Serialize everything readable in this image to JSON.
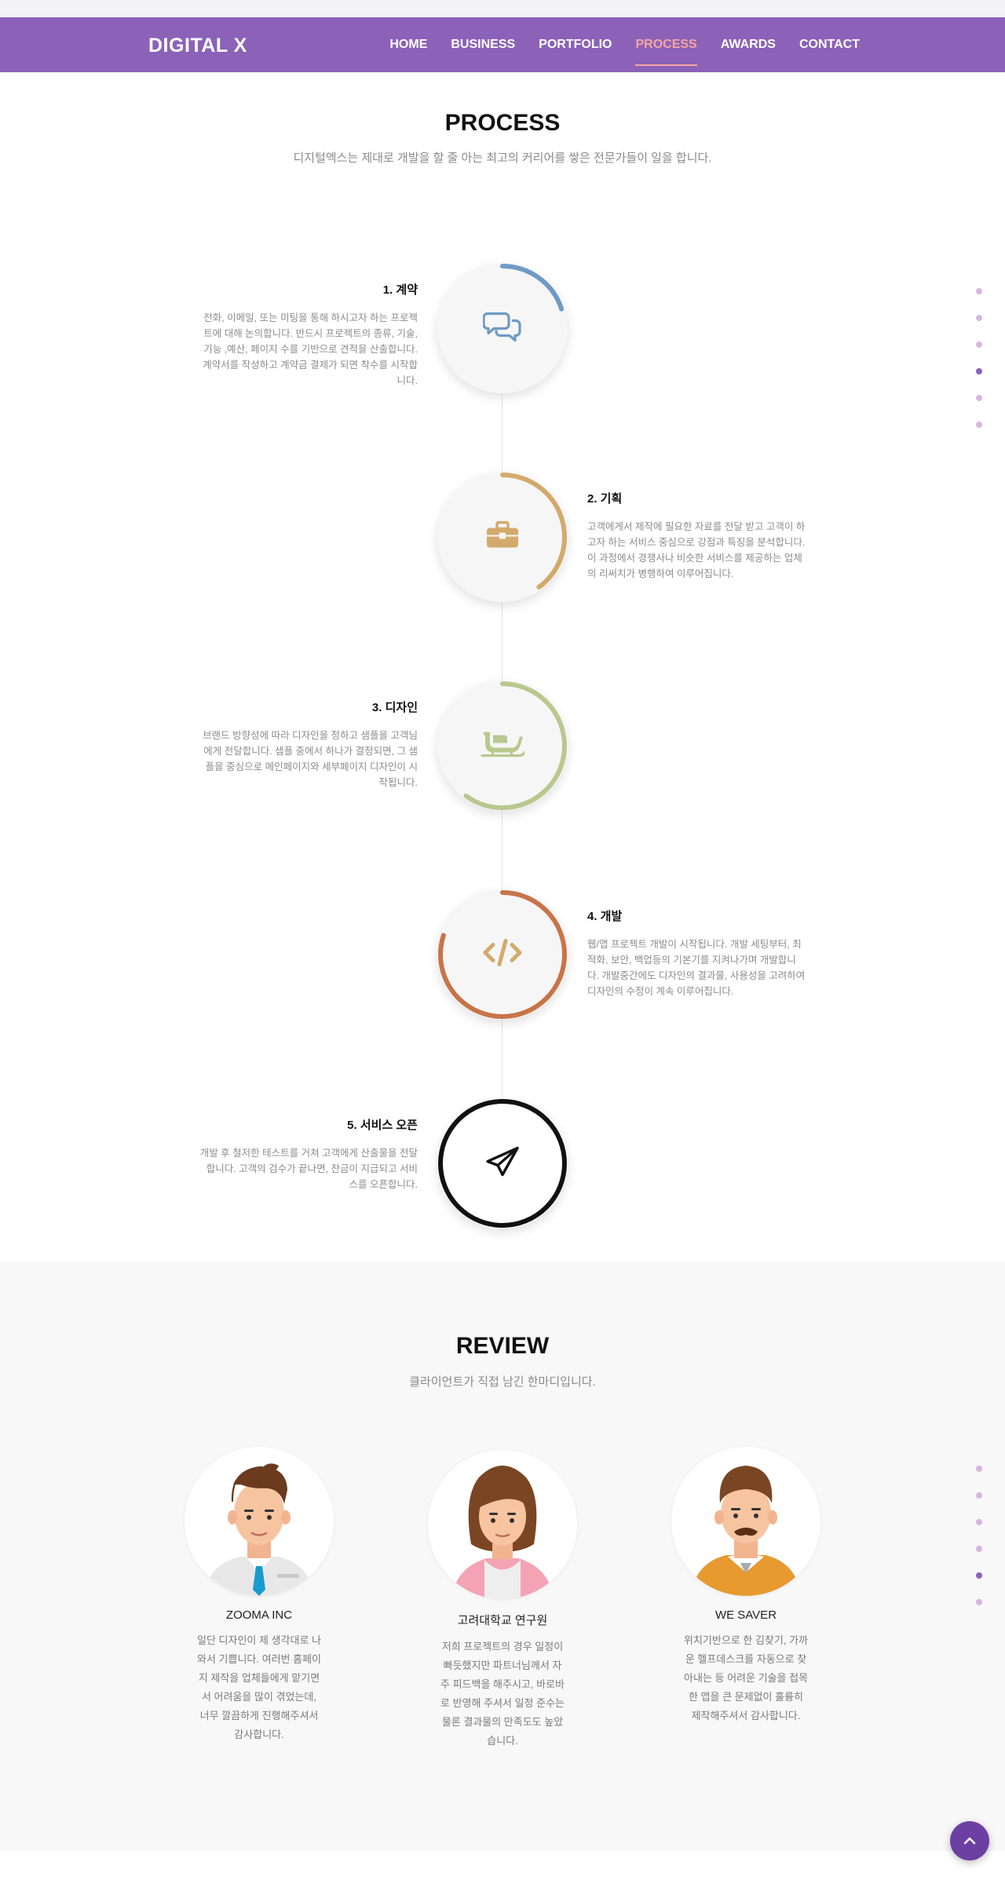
{
  "brand": {
    "logo": "DIGITAL X"
  },
  "nav": [
    {
      "label": "HOME",
      "active": false
    },
    {
      "label": "BUSINESS",
      "active": false
    },
    {
      "label": "PORTFOLIO",
      "active": false
    },
    {
      "label": "PROCESS",
      "active": true
    },
    {
      "label": "AWARDS",
      "active": false
    },
    {
      "label": "CONTACT",
      "active": false
    }
  ],
  "process": {
    "title": "PROCESS",
    "subtitle": "디지털엑스는 제대로 개발을 할 줄 아는 최고의 커리어를 쌓은 전문가들이 일을 합니다.",
    "steps": [
      {
        "title": "1. 계약",
        "desc": "전화, 이메일, 또는 미팅을 통해 하시고자 하는 프로젝트에 대해 논의합니다. 반드시 프로젝트의 종류, 기술, 기능 ,예산, 페이지 수를 기반으로 견적을 산출합니다. 계약서를 작성하고 계약금 결제가 되면 착수를 시작합니다.",
        "color": "#6e9ac4",
        "progress": 0.2,
        "icon": "chat-icon"
      },
      {
        "title": "2. 기획",
        "desc": "고객에게서 제작에 필요한 자료를 전달 받고 고객이 하고자 하는 서비스 중심으로 강점과 특징을 분석합니다. 이 과정에서 경쟁사나 비슷한 서비스를 제공하는 업체의 리써치가 병행하여 이루어집니다.",
        "color": "#d3aa6c",
        "progress": 0.4,
        "icon": "briefcase-icon"
      },
      {
        "title": "3. 디자인",
        "desc": "브랜드 방향성에 따라 디자인을 정하고 샘플을 고객님에게 전달합니다. 샘플 중에서 하나가 결정되면, 그 샘플을 중심으로 메인페이지와 세부페이지 디자인이 시작됩니다.",
        "color": "#b8c88e",
        "progress": 0.6,
        "icon": "sleigh-icon"
      },
      {
        "title": "4. 개발",
        "desc": "웹/앱 프로젝트 개발이 시작됩니다. 개발 세팅부터, 최적화, 보안, 백업등의 기본기를 지켜나가며 개발합니다. 개발중간에도 디자인의 결과물, 사용성을 고려하여 디자인의 수정이 계속 이루어집니다.",
        "color": "#c87448",
        "progress": 0.8,
        "icon": "code-icon"
      },
      {
        "title": "5. 서비스 오픈",
        "desc": "개발 후 철저한 테스트를 거쳐 고객에게 산출물을 전달합니다. 고객의 검수가 끝나면, 잔금이 지급되고 서비스를 오픈합니다.",
        "color": "#111111",
        "progress": 1.0,
        "icon": "paper-plane-icon"
      }
    ]
  },
  "review": {
    "title": "REVIEW",
    "subtitle": "클라이언트가 직접 남긴 한마디입니다.",
    "items": [
      {
        "name": "ZOOMA INC",
        "text": "일단 디자인이 제 생각대로 나와서 기쁩니다. 여러번 홈페이지 제작을 업체들에게 맡기면서 어려움을 많이 겪었는데, 너무 깔끔하게 진행해주셔서 감사합니다."
      },
      {
        "name": "고려대학교 연구원",
        "text": "저희 프로젝트의 경우 일정이 빠듯했지만 파트너님께서 자주 피드백을 해주시고, 바로바로 반영해 주셔서 일정 준수는 물론 결과물의 만족도도 높았습니다."
      },
      {
        "name": "WE SAVER",
        "text": "위치기반으로 한 김찾기, 가까운 헬프데스크를 자동으로 찾아내는 등 어려운 기술을 접목한 앱을 큰 문제없이 훌륭히 제작해주셔서 감사합니다."
      }
    ]
  },
  "side_dots_process": {
    "count": 6,
    "active_index": 3
  },
  "side_dots_review": {
    "count": 6,
    "active_index": 4
  },
  "scroll_top": {
    "icon": "chevron-up-icon",
    "color": "#6c3fa3"
  },
  "colors": {
    "header": "#8b62b8",
    "accent": "#f6a5a0"
  }
}
